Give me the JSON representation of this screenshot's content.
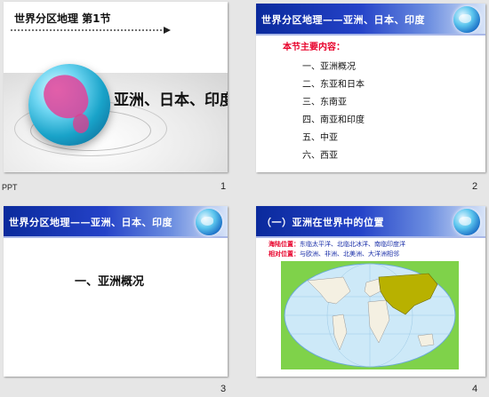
{
  "slides": [
    {
      "number": "1",
      "title": "世界分区地理 第1节",
      "heading": "亚洲、日本、印度",
      "side_label": "PPT"
    },
    {
      "number": "2",
      "header": "世界分区地理——亚洲、日本、印度",
      "subtitle": "本节主要内容：",
      "items": [
        "一、亚洲概况",
        "二、东亚和日本",
        "三、东南亚",
        "四、南亚和印度",
        "五、中亚",
        "六、西亚"
      ]
    },
    {
      "number": "3",
      "header": "世界分区地理——亚洲、日本、印度",
      "body": "一、亚洲概况"
    },
    {
      "number": "4",
      "header": "（一）亚洲在世界中的位置",
      "line1_label": "海陆位置：",
      "line1_text": "东临太平洋、北临北冰洋、南临印度洋",
      "line2_label": "相对位置：",
      "line2_text": "与欧洲、非洲、北美洲、大洋洲相邻"
    }
  ],
  "colors": {
    "header_blue": "#0a2a9c",
    "accent_red": "#e8002a",
    "map_ocean": "#cde9f8",
    "asia": "#b8b100"
  }
}
